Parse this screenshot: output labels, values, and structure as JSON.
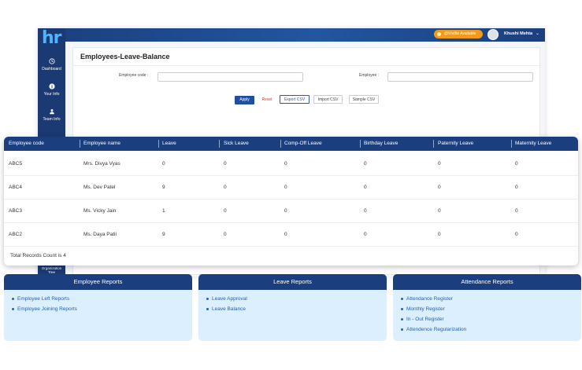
{
  "app": {
    "logo": "hr",
    "waffle_label": "@Waffle Available",
    "user_name": "Khushi Mehta",
    "sidebar": [
      {
        "label": "Dashboard",
        "icon": "clock-icon"
      },
      {
        "label": "Your Info",
        "icon": "info-icon"
      },
      {
        "label": "Team Info",
        "icon": "team-icon"
      }
    ],
    "sidebar_tail_label": "Organization Tree"
  },
  "page": {
    "title": "Employees-Leave-Balance",
    "employee_code_label": "Employee code :",
    "employee_code_value": "",
    "employee_label": "Employee :",
    "employee_value": "",
    "buttons": {
      "apply": "Apply",
      "reset": "Reset",
      "export": "Export CSV",
      "import": "Import CSV",
      "sample": "Sample CSV"
    }
  },
  "table": {
    "headers": [
      "Employee code",
      "Employee name",
      "Leave",
      "Sick Leave",
      "Comp-Off Leave",
      "Birthday Leave",
      "Paternity Leave",
      "Maternity Leave"
    ],
    "rows": [
      [
        "ABC5",
        "Mrs. Divya Vyas",
        "0",
        "0",
        "0",
        "0",
        "0",
        "0"
      ],
      [
        "ABC4",
        "Ms. Dev Patel",
        "9",
        "0",
        "0",
        "0",
        "0",
        "0"
      ],
      [
        "ABC3",
        "Ms. Vicky Jain",
        "1",
        "0",
        "0",
        "0",
        "0",
        "0"
      ],
      [
        "ABC2",
        "Ms. Daya Patil",
        "9",
        "0",
        "0",
        "0",
        "0",
        "0"
      ]
    ],
    "total": "Total Records Count is 4"
  },
  "reports": [
    {
      "title": "Employee Reports",
      "items": [
        "Employee Left Reports",
        "Employee Joining Reports"
      ]
    },
    {
      "title": "Leave Reports",
      "items": [
        "Leave Approval",
        "Leave Balance"
      ]
    },
    {
      "title": "Attendance Reports",
      "items": [
        "Attendance Register",
        "Monthly Register",
        "In - Out Register",
        "Attendence Regularization"
      ]
    }
  ],
  "colors": {
    "primary": "#1b3f7e",
    "accent": "#f39a1b",
    "link": "#2462b3",
    "panel_bg": "#dcefff"
  }
}
